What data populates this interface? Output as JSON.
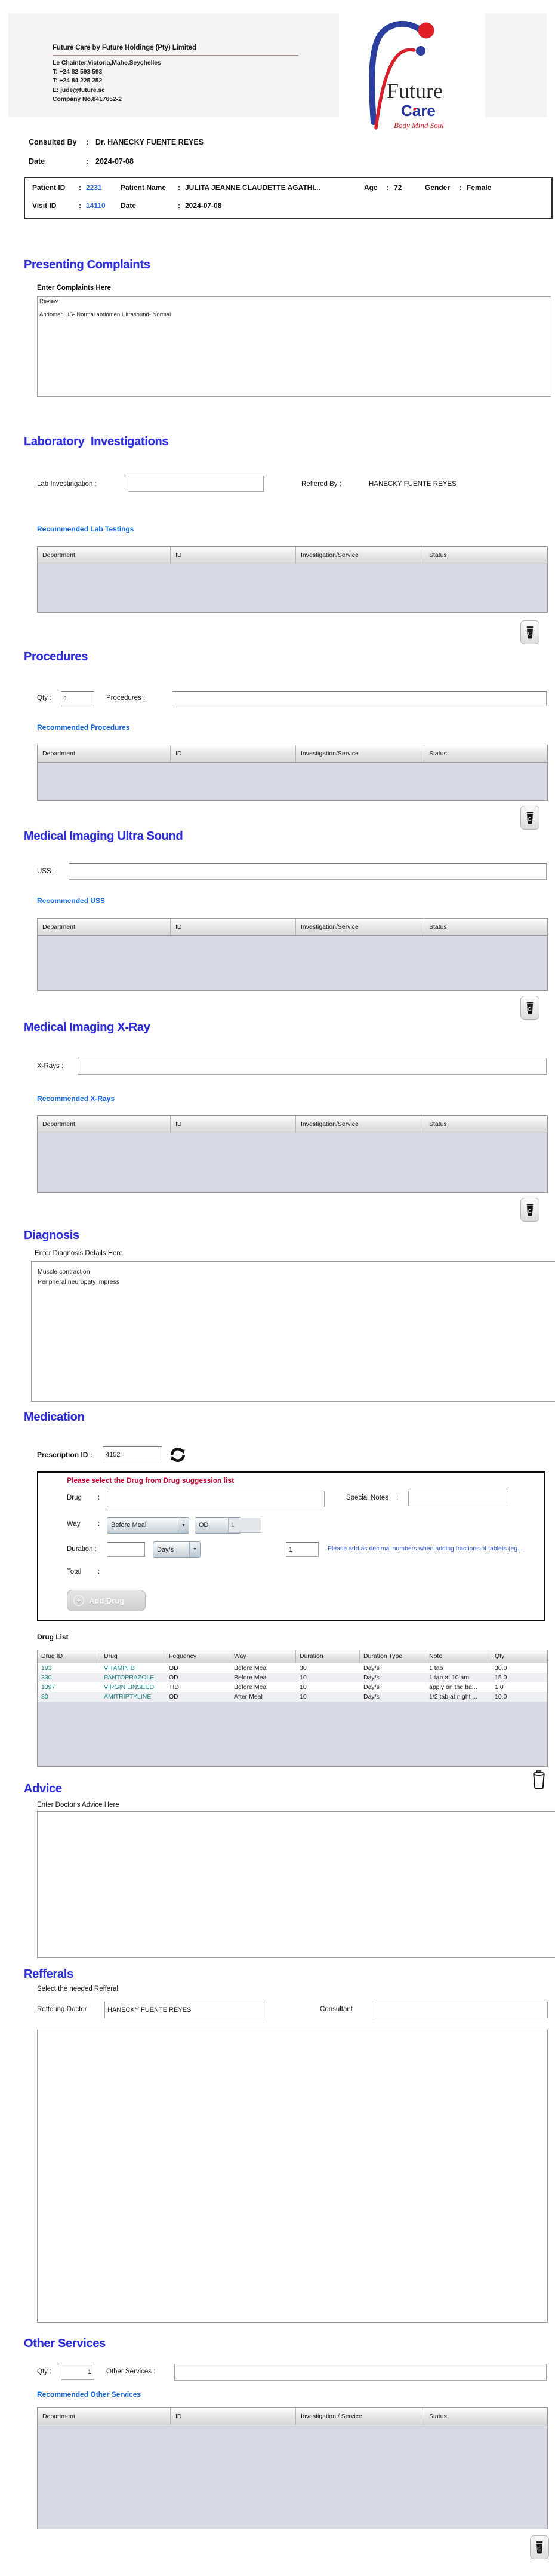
{
  "ui": {
    "colon": ":"
  },
  "colors": {
    "heading_blue": "#2d2dd5",
    "link_blue": "#1569e8",
    "id_blue": "#2d6be6",
    "warning_red": "#cc0033",
    "helper_blue": "#2a52d8",
    "drug_teal": "#1d8788",
    "table_body_gray": "#d6d9e3"
  },
  "icons": {
    "delete": "trash-icon",
    "delete_outline": "trash-outline-icon",
    "refresh": "refresh-icon",
    "add": "circle-plus-icon",
    "dropdown": "chevron-down-icon",
    "logo": "future-care-logo"
  },
  "company": {
    "name": "Future Care by Future Holdings (Pty) Limited",
    "address": "Le Chainter,Victoria,Mahe,Seychelles",
    "phone1": "T: +24  82 593 593",
    "phone2": "T: +24  84 225 252",
    "email": "E: jude@future.sc",
    "company_no": "Company No.8417652-2",
    "logo_word1": "Future",
    "logo_word2": "Care",
    "logo_tagline": "Body Mind Soul"
  },
  "consult": {
    "consulted_by_label": "Consulted By",
    "consulted_by_value": "Dr.  HANECKY FUENTE REYES",
    "date_label": "Date",
    "date_value": "2024-07-08"
  },
  "patient": {
    "patient_id_label": "Patient ID",
    "patient_id": "2231",
    "patient_name_label": "Patient Name",
    "patient_name": "JULITA JEANNE CLAUDETTE AGATHI...",
    "age_label": "Age",
    "age": "72",
    "gender_label": "Gender",
    "gender": "Female",
    "visit_id_label": "Visit ID",
    "visit_id": "14110",
    "visit_date_label": "Date",
    "visit_date": "2024-07-08"
  },
  "complaints": {
    "heading": "Presenting Complaints",
    "label": "Enter Complaints Here",
    "text": "Review\n\nAbdomen US- Normal abdomen Ultrasound- Normal"
  },
  "laboratory": {
    "heading": "Laboratory  Investigations",
    "input_label": "Lab Investingation :",
    "input_value": "",
    "referred_label": "Reffered By :",
    "referred_value": "HANECKY FUENTE REYES",
    "recommended_label": "Recommended Lab Testings",
    "table_headers": [
      "Department",
      "ID",
      "Investigation/Service",
      "Status"
    ]
  },
  "procedures": {
    "heading": "Procedures",
    "qty_label": "Qty :",
    "qty_value": "1",
    "input_label": "Procedures :",
    "input_value": "",
    "recommended_label": "Recommended Procedures",
    "table_headers": [
      "Department",
      "ID",
      "Investigation/Service",
      "Status"
    ]
  },
  "ultrasound": {
    "heading": "Medical Imaging Ultra Sound",
    "input_label": "USS :",
    "input_value": "",
    "recommended_label": "Recommended USS",
    "table_headers": [
      "Department",
      "ID",
      "Investigation/Service",
      "Status"
    ]
  },
  "xray": {
    "heading": "Medical Imaging X-Ray",
    "input_label": "X-Rays :",
    "input_value": "",
    "recommended_label": "Recommended X-Rays",
    "table_headers": [
      "Department",
      "ID",
      "Investigation/Service",
      "Status"
    ]
  },
  "diagnosis": {
    "heading": "Diagnosis",
    "label": "Enter Diagnosis Details Here",
    "text": "Muscle contraction\nPeripheral neuropaty impress"
  },
  "medication": {
    "heading": "Medication",
    "prescription_label": "Prescription ID :",
    "prescription_id": "4152",
    "warning": "Please select the Drug from Drug suggession list",
    "drug_label": "Drug",
    "drug_value": "",
    "special_notes_label": "Special Notes",
    "special_notes_value": "",
    "way_label": "Way",
    "way_value": "Before Meal",
    "frequency_value": "OD",
    "dose_value": "1",
    "duration_label": "Duration :",
    "duration_value": "",
    "duration_type_value": "Day/s",
    "qty_value": "1",
    "helper": "Please add as decimal numbers when adding fractions of tablets (eg...",
    "total_label": "Total",
    "add_drug_label": "Add Drug",
    "drug_list_label": "Drug List",
    "table_headers": [
      "Drug ID",
      "Drug",
      "Fequency",
      "Way",
      "Duration",
      "Duration Type",
      "Note",
      "Qty"
    ],
    "rows": [
      [
        "193",
        "VITAMIN B",
        "OD",
        "Before Meal",
        "30",
        "Day/s",
        "1 tab",
        "30.0"
      ],
      [
        "330",
        "PANTOPRAZOLE",
        "OD",
        "Before Meal",
        "10",
        "Day/s",
        "1 tab at 10 am",
        "15.0"
      ],
      [
        "1397",
        "VIRGIN LINSEED",
        "TID",
        "Before Meal",
        "10",
        "Day/s",
        "apply on the ba...",
        "1.0"
      ],
      [
        "80",
        "AMITRIPTYLINE",
        "OD",
        "After Meal",
        "10",
        "Day/s",
        "1/2 tab at night ...",
        "10.0"
      ]
    ]
  },
  "advice": {
    "heading": "Advice",
    "label": "Enter Doctor's Advice Here",
    "text": ""
  },
  "referrals": {
    "heading": "Refferals",
    "label": "Select the needed Refferal",
    "doctor_label": "Reffering Doctor",
    "doctor_value": "HANECKY FUENTE REYES",
    "consultant_label": "Consultant",
    "consultant_value": ""
  },
  "other_services": {
    "heading": "Other Services",
    "qty_label": "Qty :",
    "qty_value": "1",
    "input_label": "Other Services :",
    "input_value": "",
    "recommended_label": "Recommended Other Services",
    "table_headers": [
      "Department",
      "ID",
      "Investigation / Service",
      "Status"
    ]
  }
}
